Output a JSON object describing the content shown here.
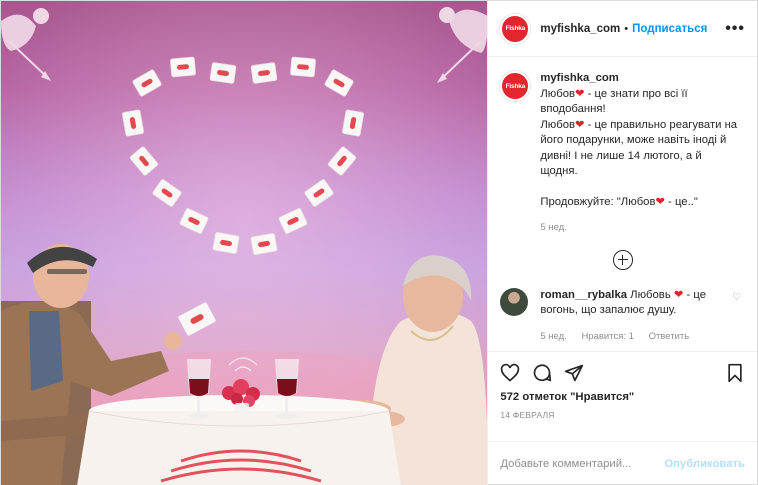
{
  "account": {
    "avatar_text": "Fishka",
    "username": "myfishka_com",
    "separator": "•",
    "follow_label": "Подписаться",
    "more_label": "•••"
  },
  "caption": {
    "username": "myfishka_com",
    "line1_a": "Любов",
    "line1_b": " - це знати про всі її вподобання!",
    "line2_a": "Любов",
    "line2_b": " - це правильно реагувати на його подарунки, може навіть іноді й дивні! І не лише 14 лютого, а й щодня.",
    "line3_a": "Продовжуйте: \"Любов",
    "line3_b": " - це..\"",
    "heart": "❤",
    "time": "5 нед."
  },
  "comment": {
    "username": "roman__rybalka",
    "text_a": "Любовь ",
    "text_b": " - це вогонь, що запалює душу.",
    "heart": "❤",
    "time": "5 нед.",
    "likes": "Нравится: 1",
    "reply": "Ответить",
    "like_icon": "♡"
  },
  "actions": {
    "likes": "572 отметок \"Нравится\"",
    "date": "14 ФЕВРАЛЯ"
  },
  "add_comment": {
    "placeholder": "Добавьте комментарий...",
    "publish": "Опубликовать"
  },
  "photo": {
    "tag_label": "FISHKA"
  }
}
